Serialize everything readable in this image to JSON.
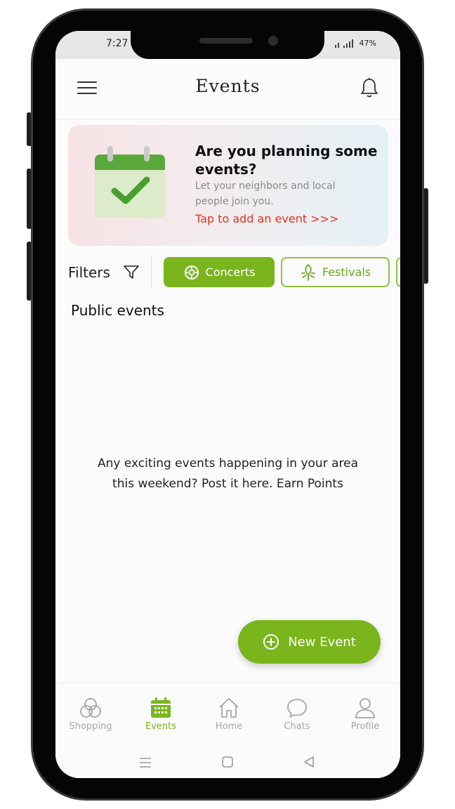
{
  "status": {
    "time": "7:27",
    "battery": "47%"
  },
  "header": {
    "title": "Events"
  },
  "banner": {
    "title": "Are you planning some events?",
    "subtitle": "Let your neighbors and local people join you.",
    "cta": "Tap to add an event >>>"
  },
  "filters": {
    "label": "Filters",
    "chips": [
      {
        "label": "Concerts",
        "active": true
      },
      {
        "label": "Festivals",
        "active": false
      }
    ]
  },
  "section": {
    "title": "Public events"
  },
  "empty_state": {
    "line1": "Any exciting events happening in your area",
    "line2": "this weekend? Post it here. Earn Points"
  },
  "fab": {
    "label": "New Event"
  },
  "bottom_nav": {
    "items": [
      {
        "label": "Shopping",
        "icon": "shopping-icon"
      },
      {
        "label": "Events",
        "icon": "calendar-icon",
        "active": true
      },
      {
        "label": "Home",
        "icon": "home-icon"
      },
      {
        "label": "Chats",
        "icon": "chat-icon"
      },
      {
        "label": "Profile",
        "icon": "profile-icon"
      }
    ]
  },
  "colors": {
    "accent": "#7ab51d",
    "cta": "#e2321c"
  }
}
